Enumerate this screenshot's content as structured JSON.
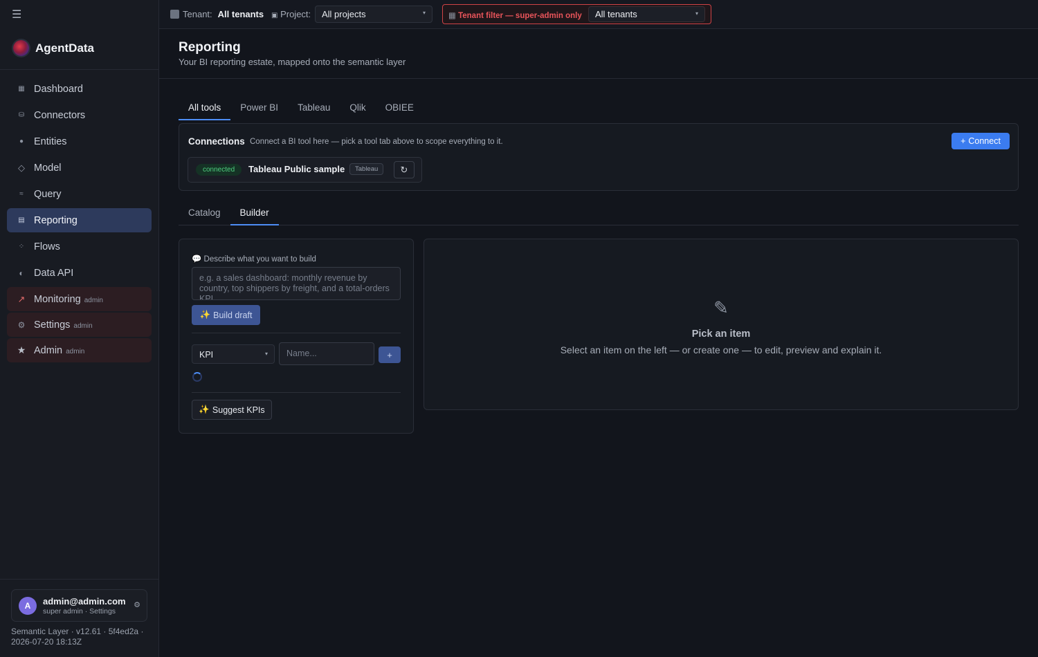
{
  "sidebar": {
    "brand": "AgentData",
    "items": [
      {
        "label": "Dashboard",
        "icon": "dashboard-icon",
        "glyph": "▦"
      },
      {
        "label": "Connectors",
        "icon": "database-icon",
        "glyph": "⛁"
      },
      {
        "label": "Entities",
        "icon": "entities-icon",
        "glyph": "●"
      },
      {
        "label": "Model",
        "icon": "model-icon",
        "glyph": "◇"
      },
      {
        "label": "Query",
        "icon": "query-icon",
        "glyph": "≈"
      },
      {
        "label": "Reporting",
        "icon": "reporting-icon",
        "glyph": "▤"
      },
      {
        "label": "Flows",
        "icon": "flows-icon",
        "glyph": "⁘"
      },
      {
        "label": "Data API",
        "icon": "data-api-icon",
        "glyph": "◐"
      }
    ],
    "admin_items": [
      {
        "label": "Monitoring",
        "tag": "admin",
        "icon": "chart-icon",
        "glyph": "📈"
      },
      {
        "label": "Settings",
        "tag": "admin",
        "icon": "gear-icon",
        "glyph": "⚙"
      },
      {
        "label": "Admin",
        "tag": "admin",
        "icon": "star-icon",
        "glyph": "★"
      }
    ],
    "user": {
      "avatar": "A",
      "email": "admin@admin.com",
      "role": "super admin · Settings"
    },
    "version_line1": "Semantic Layer · v12.61 · 5f4ed2a ·",
    "version_line2": "2026-07-20 18:13Z"
  },
  "topbar": {
    "tenant_label": "Tenant:",
    "tenant_value": "All tenants",
    "project_label": "Project:",
    "project_value": "All projects",
    "superadmin_label": "Tenant filter — super-admin only",
    "superadmin_value": "All tenants"
  },
  "header": {
    "title": "Reporting",
    "subtitle": "Your BI reporting estate, mapped onto the semantic layer"
  },
  "tool_tabs": [
    "All tools",
    "Power BI",
    "Tableau",
    "Qlik",
    "OBIEE"
  ],
  "connections": {
    "title": "Connections",
    "description": "Connect a BI tool here — pick a tool tab above to scope everything to it.",
    "connect_label": "Connect",
    "items": [
      {
        "status": "connected",
        "name": "Tableau Public sample",
        "tool": "Tableau"
      }
    ]
  },
  "sub_tabs": [
    "Catalog",
    "Builder"
  ],
  "builder": {
    "describe_label": "Describe what you want to build",
    "describe_placeholder": "e.g. a sales dashboard: monthly revenue by country, top shippers by freight, and a total-orders KPI",
    "build_label": "Build draft",
    "kind_value": "KPI",
    "name_placeholder": "Name...",
    "add_label": "+",
    "suggest_label": "Suggest KPIs"
  },
  "detail": {
    "title": "Pick an item",
    "subtitle": "Select an item on the left — or create one — to edit, preview and explain it."
  },
  "colors": {
    "accent": "#3b7cf0",
    "danger": "#e8545a",
    "success": "#4fd080"
  }
}
